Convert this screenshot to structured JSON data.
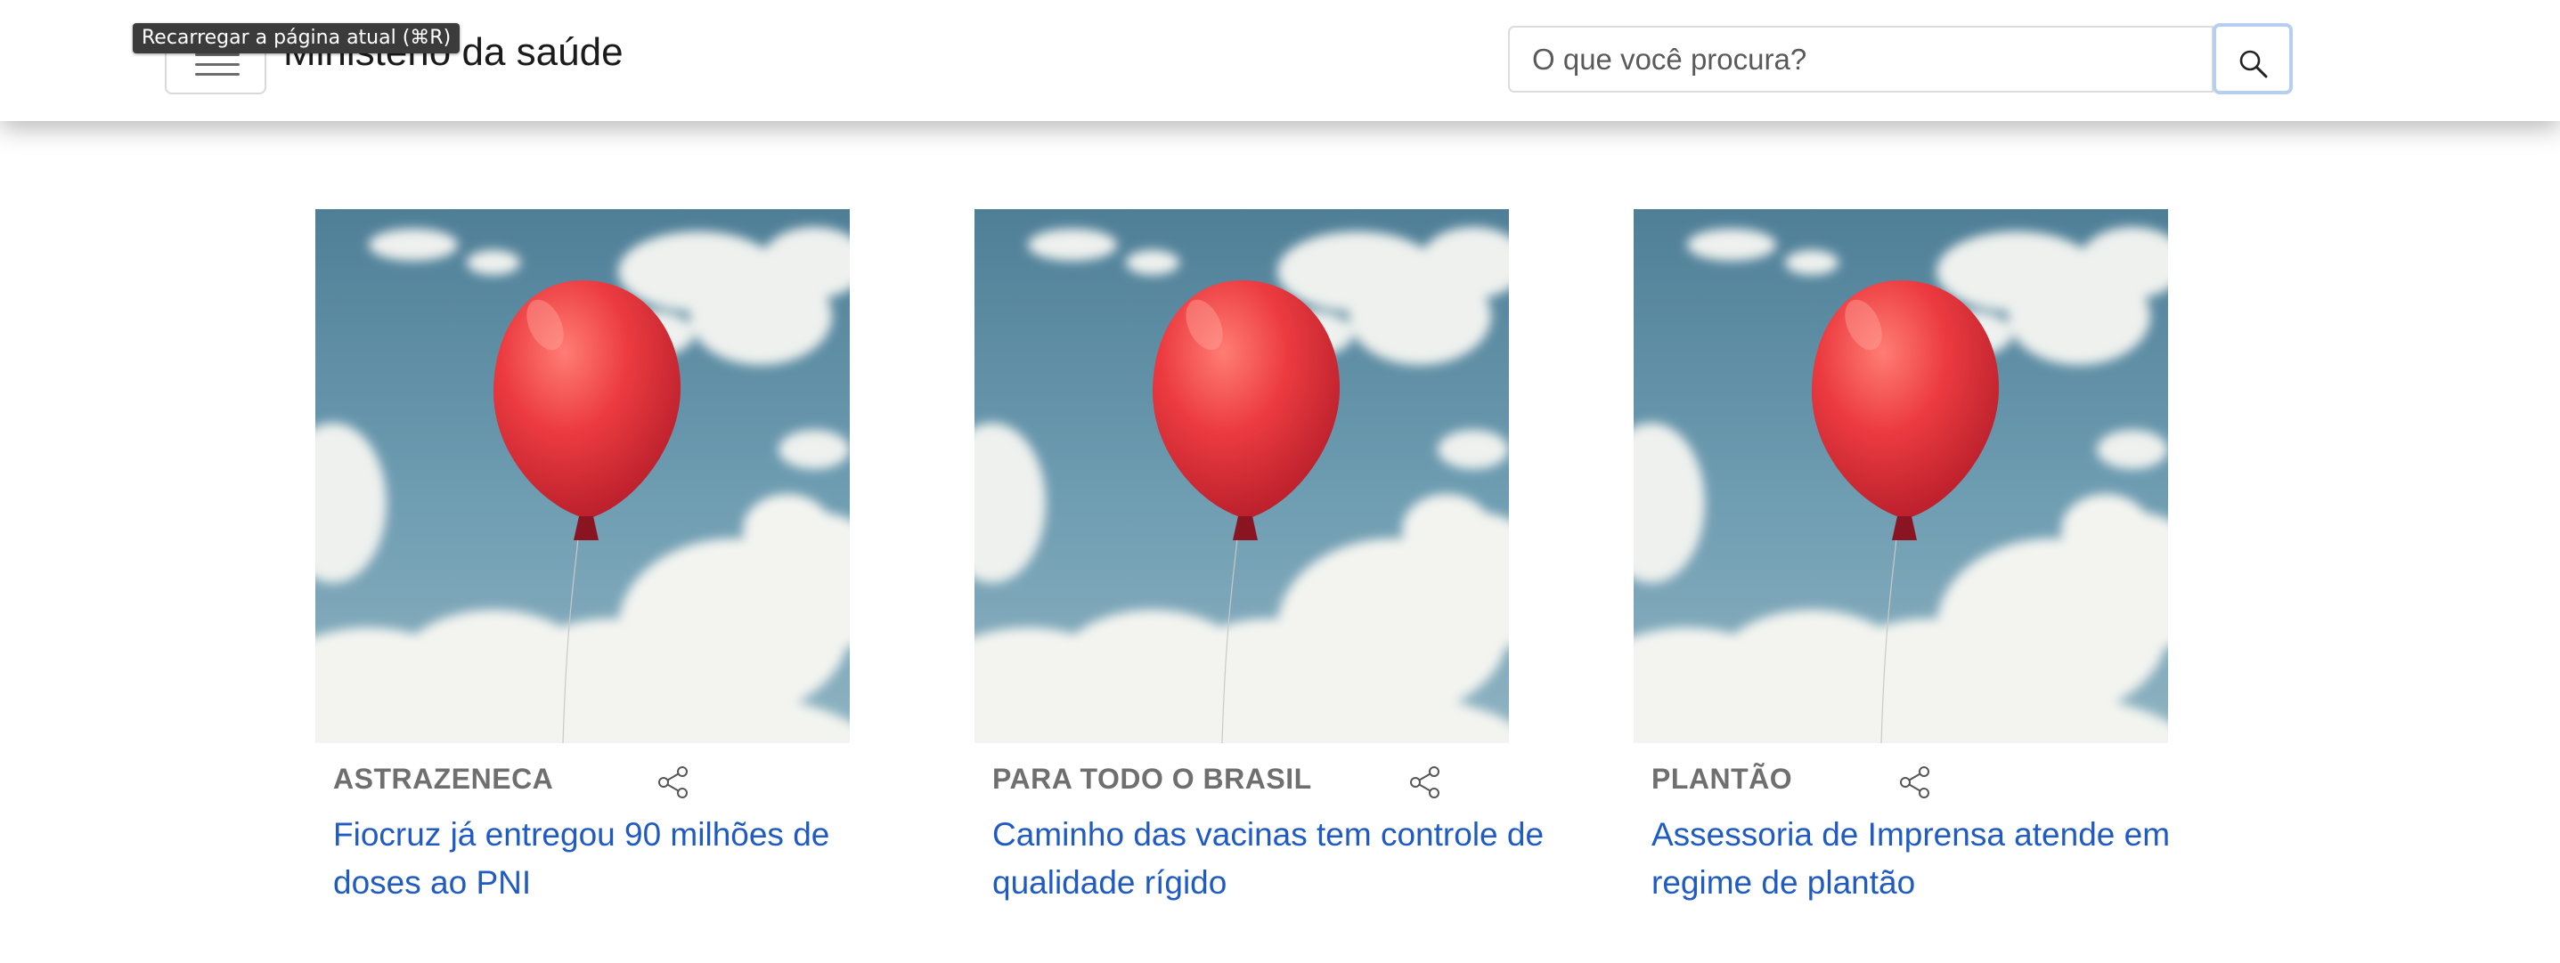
{
  "header": {
    "site_title": "Ministério da saúde",
    "tooltip": "Recarregar a página atual (⌘R)",
    "search_placeholder": "O que você procura?",
    "search_icon": "search-icon",
    "menu_icon": "hamburger-menu-icon"
  },
  "cards": [
    {
      "category": "ASTRAZENECA",
      "title_line1": "Fiocruz já entregou 90 milhões de",
      "title_line2": "doses ao PNI",
      "image": "red-balloon-sky"
    },
    {
      "category": "PARA TODO O BRASIL",
      "title_line1": "Caminho das vacinas tem controle de",
      "title_line2": "qualidade rígido",
      "image": "red-balloon-sky"
    },
    {
      "category": "PLANTÃO",
      "title_line1": "Assessoria de Imprensa atende em",
      "title_line2": "regime de plantão",
      "image": "red-balloon-sky"
    }
  ],
  "colors": {
    "link": "#1f5bc2",
    "category": "#6f6f6f",
    "sky": "#5f8fa6",
    "balloon": "#e8333a"
  }
}
